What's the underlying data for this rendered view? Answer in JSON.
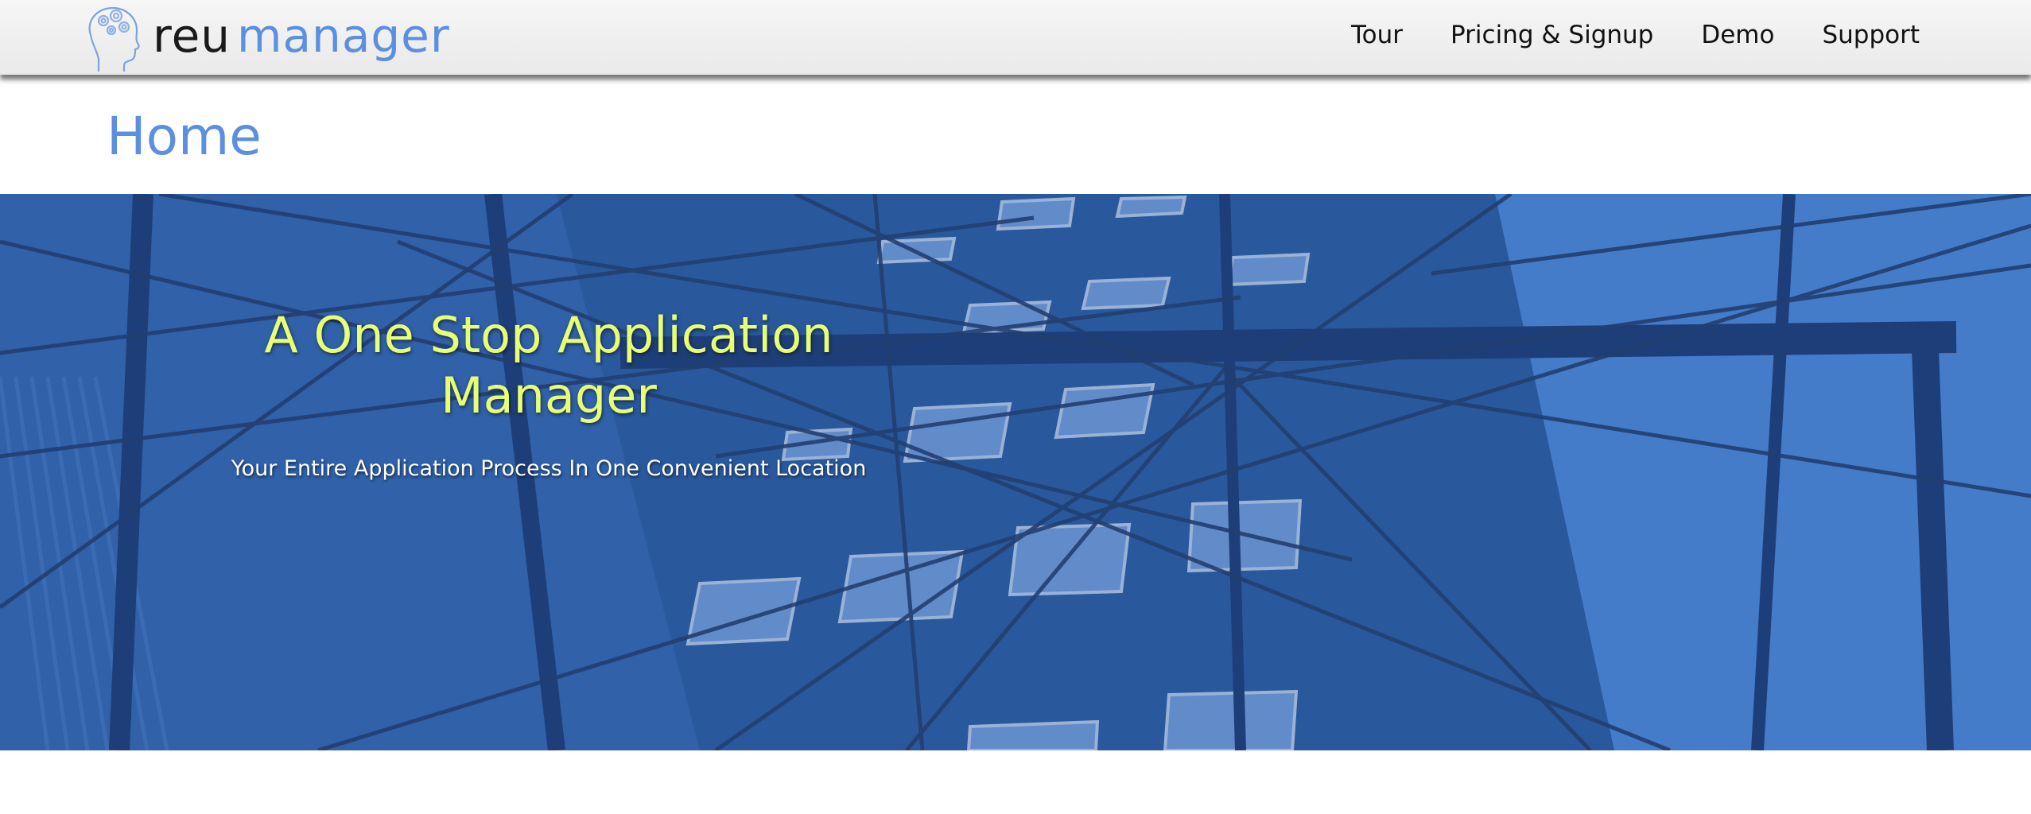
{
  "brand": {
    "name_part1": "reu",
    "name_part2": "manager",
    "logo_icon": "head-with-gears-icon",
    "colors": {
      "dark": "#1a1a1a",
      "accent": "#5b8fe0"
    }
  },
  "nav": {
    "items": [
      {
        "label": "Tour"
      },
      {
        "label": "Pricing & Signup"
      },
      {
        "label": "Demo"
      },
      {
        "label": "Support"
      }
    ]
  },
  "page": {
    "title": "Home",
    "title_color": "#5b8fe0"
  },
  "hero": {
    "heading": "A One Stop Application Manager",
    "subheading": "Your Entire Application Process In One Convenient Location",
    "heading_color": "#e8ff73",
    "background_color": "#2c60ad"
  }
}
